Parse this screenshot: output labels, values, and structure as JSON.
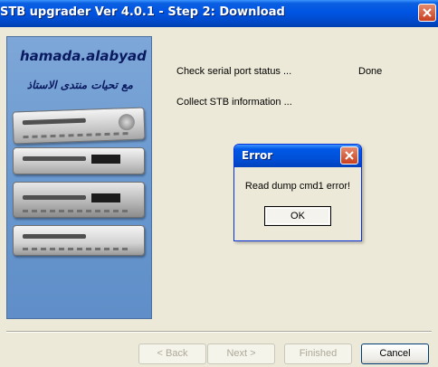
{
  "window": {
    "title": "STB upgrader Ver 4.0.1 - Step 2: Download"
  },
  "side_panel": {
    "brand": "hamada.alabyad",
    "arabic_text": "مع تحيات منتدى الاستاذ"
  },
  "steps": [
    {
      "label": "Check serial port status ...",
      "status": "Done"
    },
    {
      "label": "Collect STB information ...",
      "status": ""
    }
  ],
  "error_dialog": {
    "title": "Error",
    "message": "Read dump cmd1 error!",
    "ok_label": "OK"
  },
  "buttons": {
    "back": "< Back",
    "next": "Next >",
    "finished": "Finished",
    "cancel": "Cancel"
  },
  "colors": {
    "titlebar": "#0054e3",
    "window_bg": "#ece9d8",
    "panel_bg": "#6a99d0",
    "close_button": "#c9401f"
  },
  "icons": [
    "close-icon",
    "close-icon"
  ]
}
